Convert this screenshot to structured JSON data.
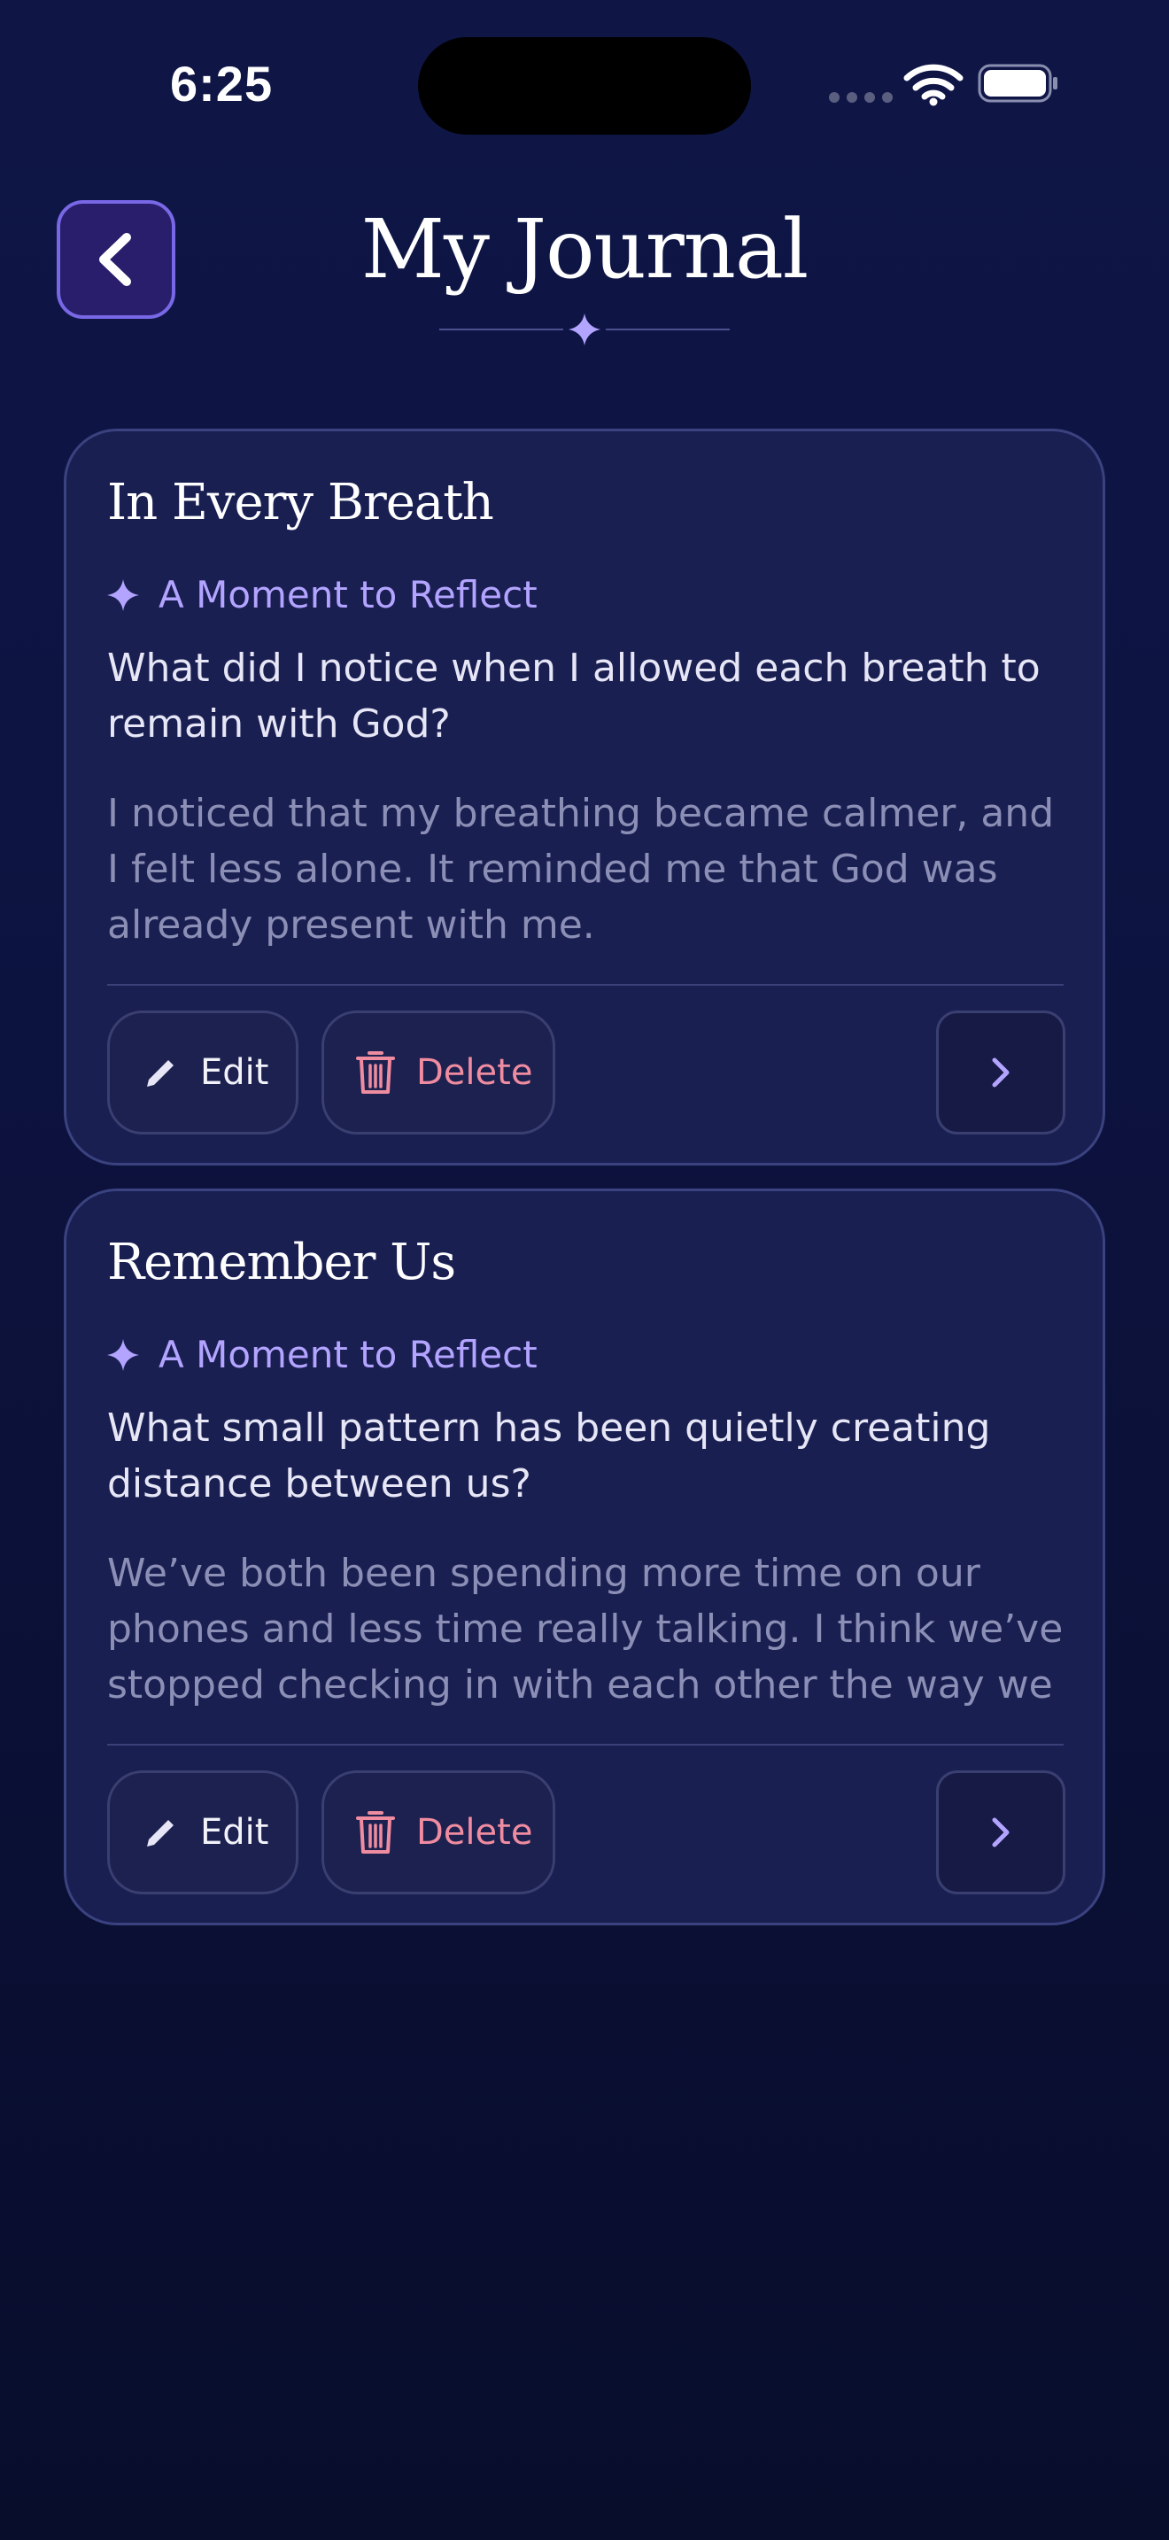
{
  "status_bar": {
    "time": "6:25"
  },
  "header": {
    "title": "My Journal"
  },
  "entries": [
    {
      "title": "In Every Breath",
      "section_label": "A Moment to Reflect",
      "prompt": "What did I notice when I allowed each breath to remain with God?",
      "entry_text": "I noticed that my breathing became calmer, and I felt less alone. It reminded me that God was already present with me.",
      "edit_label": "Edit",
      "delete_label": "Delete"
    },
    {
      "title": "Remember Us",
      "section_label": "A Moment to Reflect",
      "prompt": "What small pattern has been quietly creating distance between us?",
      "entry_text": "We’ve both been spending more time on our phones and less time really talking. I think we’ve stopped checking in with each other the way we",
      "edit_label": "Edit",
      "delete_label": "Delete"
    }
  ],
  "icons": {
    "back": "chevron-left-icon",
    "sparkle": "sparkle-icon",
    "edit": "pencil-icon",
    "delete": "trash-icon",
    "open": "chevron-right-icon"
  },
  "colors": {
    "accent": "#b3a4ff",
    "delete": "#f08ca0",
    "background": "#0d1442",
    "card": "#1a1f52"
  }
}
